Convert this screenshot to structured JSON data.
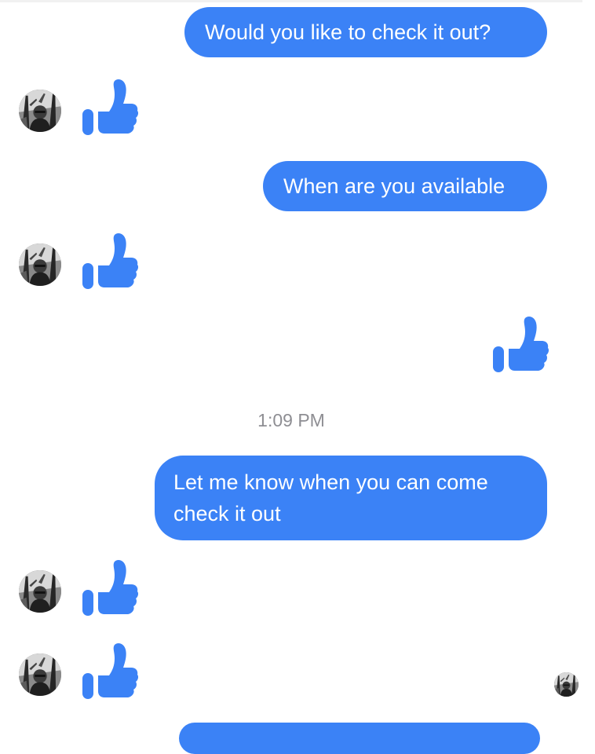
{
  "accent_color": "#3b82f6",
  "messages": [
    {
      "from": "me",
      "text": "Would you like to check it out?"
    },
    {
      "from": "them",
      "reaction": "thumbs-up-icon"
    },
    {
      "from": "me",
      "text": "When are you available"
    },
    {
      "from": "them",
      "reaction": "thumbs-up-icon"
    },
    {
      "from": "me",
      "reaction": "thumbs-up-icon"
    },
    {
      "from": "me",
      "text": "Let me know when you can come check it out"
    },
    {
      "from": "them",
      "reaction": "thumbs-up-icon"
    },
    {
      "from": "them",
      "reaction": "thumbs-up-icon"
    }
  ],
  "timestamp": "1:09 PM"
}
